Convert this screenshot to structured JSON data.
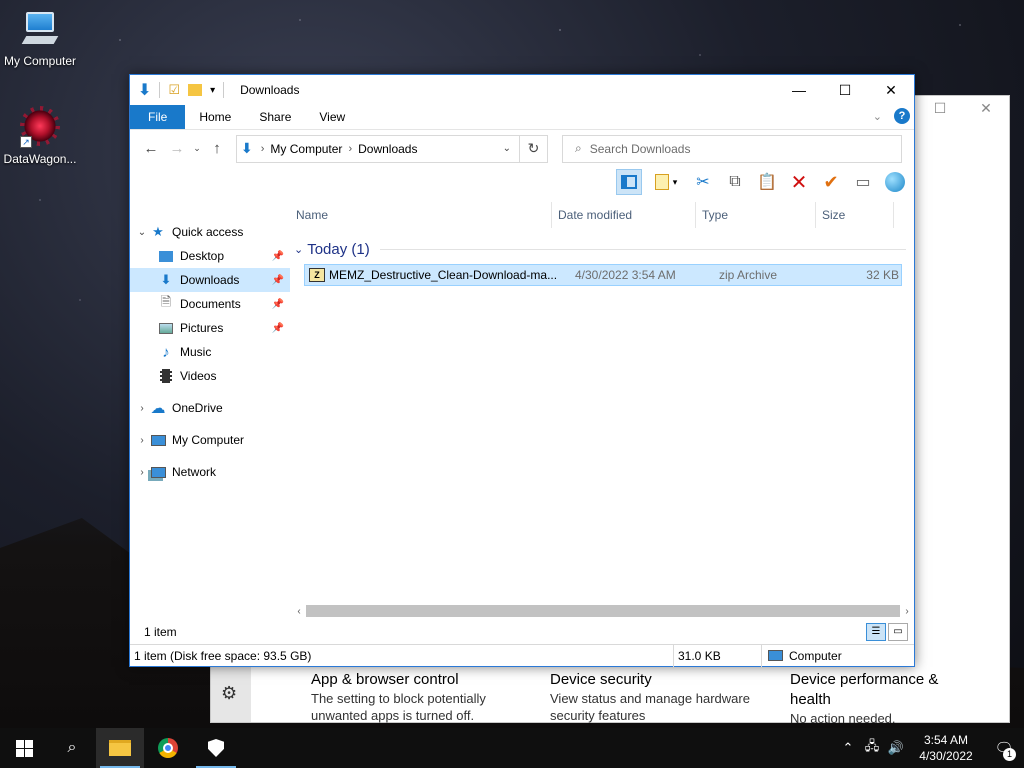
{
  "desktop": {
    "icons": [
      {
        "label": "My Computer"
      },
      {
        "label": "DataWagon..."
      }
    ]
  },
  "security_window": {
    "cards": [
      {
        "title": "App & browser control",
        "desc": "The setting to block potentially unwanted apps is turned off."
      },
      {
        "title": "Device security",
        "desc": "View status and manage hardware security features"
      },
      {
        "title": "Device performance & health",
        "desc": "No action needed."
      }
    ]
  },
  "explorer": {
    "title": "Downloads",
    "ribbon_tabs": [
      "File",
      "Home",
      "Share",
      "View"
    ],
    "address": {
      "root": "My Computer",
      "current": "Downloads"
    },
    "search_placeholder": "Search Downloads",
    "nav": {
      "quick_access": "Quick access",
      "items": [
        {
          "label": "Desktop",
          "pinned": true
        },
        {
          "label": "Downloads",
          "pinned": true,
          "selected": true
        },
        {
          "label": "Documents",
          "pinned": true
        },
        {
          "label": "Pictures",
          "pinned": true
        },
        {
          "label": "Music",
          "pinned": false
        },
        {
          "label": "Videos",
          "pinned": false
        }
      ],
      "onedrive": "OneDrive",
      "my_computer": "My Computer",
      "network": "Network"
    },
    "columns": [
      "Name",
      "Date modified",
      "Type",
      "Size"
    ],
    "group_label": "Today (1)",
    "files": [
      {
        "name": "MEMZ_Destructive_Clean-Download-ma...",
        "date": "4/30/2022 3:54 AM",
        "type": "zip Archive",
        "size": "32 KB"
      }
    ],
    "status_count": "1 item",
    "details": {
      "info": "1 item (Disk free space: 93.5 GB)",
      "size": "31.0 KB",
      "location": "Computer"
    }
  },
  "taskbar": {
    "time": "3:54 AM",
    "date": "4/30/2022",
    "notification_count": "1"
  }
}
